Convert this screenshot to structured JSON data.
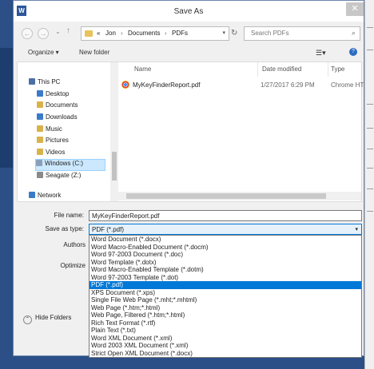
{
  "window": {
    "title": "Save As",
    "close_glyph": "✕",
    "app_badge": "W"
  },
  "address": {
    "crumbs": [
      "«",
      "Jon",
      "›",
      "Documents",
      "›",
      "PDFs"
    ],
    "search_placeholder": "Search PDFs"
  },
  "toolbar": {
    "organize": "Organize ▾",
    "new_folder": "New folder"
  },
  "tree": {
    "items": [
      {
        "label": "This PC",
        "icon": "computer-icon",
        "color": "#4a6fa5"
      },
      {
        "label": "Desktop",
        "icon": "desktop-icon",
        "color": "#3a7ac9"
      },
      {
        "label": "Documents",
        "icon": "documents-icon",
        "color": "#d9b24a"
      },
      {
        "label": "Downloads",
        "icon": "downloads-icon",
        "color": "#3a7ac9"
      },
      {
        "label": "Music",
        "icon": "music-icon",
        "color": "#d9b24a"
      },
      {
        "label": "Pictures",
        "icon": "pictures-icon",
        "color": "#d9b24a"
      },
      {
        "label": "Videos",
        "icon": "videos-icon",
        "color": "#d9b24a"
      },
      {
        "label": "Windows (C:)",
        "icon": "drive-icon",
        "color": "#8aa0b8"
      },
      {
        "label": "Seagate (Z:)",
        "icon": "drive-icon",
        "color": "#8a8a8a"
      },
      {
        "label": "Network",
        "icon": "network-icon",
        "color": "#3a7ac9"
      }
    ]
  },
  "files": {
    "columns": [
      "Name",
      "Date modified",
      "Type"
    ],
    "rows": [
      {
        "name": "MyKeyFinderReport.pdf",
        "date": "1/27/2017 6:29 PM",
        "type": "Chrome HT"
      }
    ]
  },
  "form": {
    "file_name_label": "File name:",
    "file_name_value": "MyKeyFinderReport.pdf",
    "save_type_label": "Save as type:",
    "save_type_value": "PDF (*.pdf)",
    "authors_label": "Authors",
    "optimize_label": "Optimize",
    "options": [
      "Word Document (*.docx)",
      "Word Macro-Enabled Document (*.docm)",
      "Word 97-2003 Document (*.doc)",
      "Word Template (*.dotx)",
      "Word Macro-Enabled Template (*.dotm)",
      "Word 97-2003 Template (*.dot)",
      "PDF (*.pdf)",
      "XPS Document (*.xps)",
      "Single File Web Page (*.mht;*.mhtml)",
      "Web Page (*.htm;*.html)",
      "Web Page, Filtered (*.htm;*.html)",
      "Rich Text Format (*.rtf)",
      "Plain Text (*.txt)",
      "Word XML Document (*.xml)",
      "Word 2003 XML Document (*.xml)",
      "Strict Open XML Document (*.docx)"
    ],
    "selected_option": "PDF (*.pdf)"
  },
  "footer": {
    "hide_folders": "Hide Folders"
  }
}
